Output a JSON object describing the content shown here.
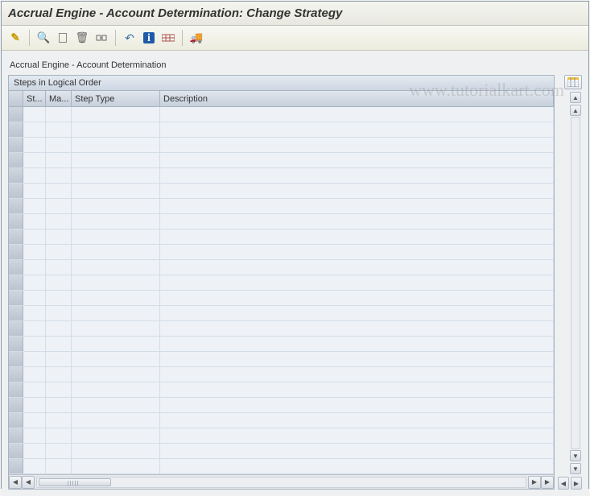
{
  "title": "Accrual Engine - Account Determination: Change Strategy",
  "subtitle": "Accrual Engine - Account Determination",
  "watermark": "www.tutorialkart.com",
  "toolbar": {
    "icons": [
      {
        "name": "edit-icon",
        "glyph": "✎",
        "color": "#c79a00"
      },
      {
        "name": "sep"
      },
      {
        "name": "display-icon",
        "glyph": "🔍",
        "color": "#3a6ea5"
      },
      {
        "name": "new-icon",
        "glyph": "▢",
        "color": "#666"
      },
      {
        "name": "delete-icon",
        "glyph": "🗑",
        "color": "#666"
      },
      {
        "name": "params-icon",
        "glyph": "⚙",
        "color": "#666"
      },
      {
        "name": "sep"
      },
      {
        "name": "back-icon",
        "glyph": "↶",
        "color": "#3a6ea5"
      },
      {
        "name": "info-icon",
        "glyph": "ℹ",
        "color": "#fff",
        "bg": "#1e5aa8"
      },
      {
        "name": "roles-icon",
        "glyph": "⊞",
        "color": "#c05050"
      },
      {
        "name": "sep"
      },
      {
        "name": "transport-icon",
        "glyph": "🚚",
        "color": "#c79a00"
      }
    ]
  },
  "panel": {
    "header": "Steps in Logical Order",
    "columns": {
      "col1": "St...",
      "col2": "Ma...",
      "col3": "Step Type",
      "col4": "Description"
    },
    "row_count": 24
  }
}
